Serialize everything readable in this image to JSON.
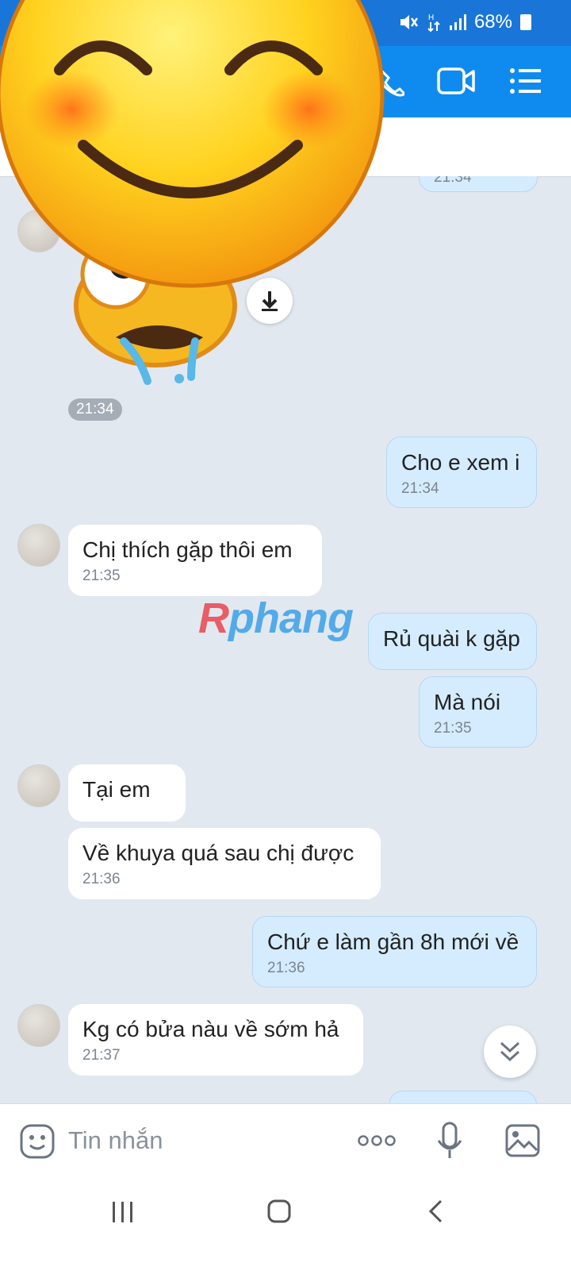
{
  "status_bar": {
    "battery": "68%"
  },
  "messages": [
    {
      "side": "out",
      "text": "",
      "time": "21:34"
    },
    {
      "side": "sticker",
      "time": "21:34"
    },
    {
      "side": "out",
      "text": "Cho e xem i",
      "time": "21:34"
    },
    {
      "side": "in",
      "text": "Chị thích gặp thôi em",
      "time": "21:35"
    },
    {
      "side": "out",
      "text": "Rủ quài k gặp",
      "time": ""
    },
    {
      "side": "out",
      "text": "Mà nói",
      "time": "21:35"
    },
    {
      "side": "in",
      "text": "Tại em",
      "time": ""
    },
    {
      "side": "in",
      "text": "Về khuya quá sau chị được",
      "time": "21:36"
    },
    {
      "side": "out",
      "text": "Chứ e làm gần 8h mới về",
      "time": "21:36"
    },
    {
      "side": "in",
      "text": "Kg có bửa nàu về sớm hả",
      "time": "21:37"
    }
  ],
  "watermark": {
    "first_letter": "R",
    "rest": "phang"
  },
  "input": {
    "placeholder": "Tin nhắn"
  },
  "colors": {
    "header": "#0f8bf0",
    "status_bar": "#1976d8",
    "outgoing_bubble": "#d4ecfe",
    "chat_bg": "#e2e8f0"
  }
}
